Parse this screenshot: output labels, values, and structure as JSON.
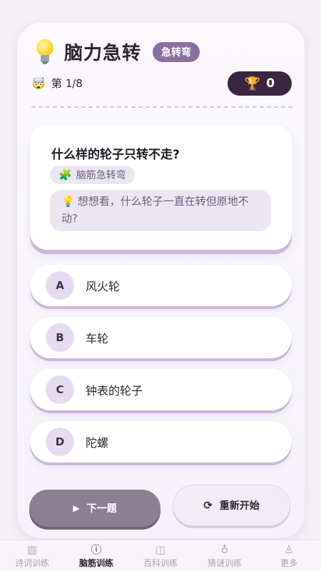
{
  "header": {
    "icon": "lightbulb-icon",
    "title": "脑力急转",
    "tag": "急转弯"
  },
  "progress": {
    "icon": "exploding-head-emoji",
    "label": "第 1/8",
    "current": 1,
    "total": 8
  },
  "score": {
    "icon": "trophy-icon",
    "value": "0"
  },
  "question": {
    "text": "什么样的轮子只转不走?",
    "category_icon": "puzzle-icon",
    "category": "脑筋急转弯",
    "hint_icon": "lightbulb-icon",
    "hint": "想想看，什么轮子一直在转但原地不动?"
  },
  "options": [
    {
      "letter": "A",
      "text": "风火轮"
    },
    {
      "letter": "B",
      "text": "车轮"
    },
    {
      "letter": "C",
      "text": "钟表的轮子"
    },
    {
      "letter": "D",
      "text": "陀螺"
    }
  ],
  "actions": {
    "next_icon": "play-icon",
    "next_label": "下一题",
    "restart_icon": "refresh-icon",
    "restart_label": "重新开始"
  },
  "tabs": [
    {
      "icon": "book-icon",
      "label": "诗词训练",
      "active": false
    },
    {
      "icon": "question-circle-icon",
      "label": "脑筋训练",
      "active": true
    },
    {
      "icon": "open-book-icon",
      "label": "百科训练",
      "active": false
    },
    {
      "icon": "lightbulb-icon",
      "label": "猜谜训练",
      "active": false
    },
    {
      "icon": "person-icon",
      "label": "更多",
      "active": false
    }
  ],
  "colors": {
    "accent": "#8a6fa0",
    "score_bg": "#3a2640",
    "next_button": "#8c7f92"
  }
}
